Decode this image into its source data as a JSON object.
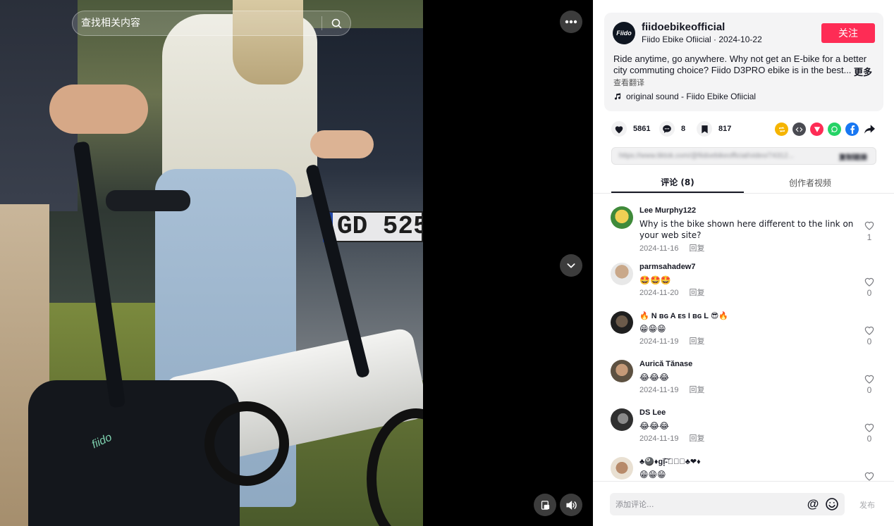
{
  "search": {
    "placeholder": "查找相关内容"
  },
  "video": {
    "plate_text": "GD 525",
    "bike_brand": "fiido"
  },
  "author": {
    "avatar_text": "Fiido",
    "handle": "fiidoebikeofficial",
    "meta": "Fiido Ebike Ofiicial · 2024-10-22",
    "follow_label": "关注"
  },
  "post": {
    "description": "Ride anytime, go anywhere. Why not get an E-bike for a better city commuting choice? Fiido D3PRO ebike is in the best...",
    "more_label": "更多",
    "translate_label": "查看翻译",
    "sound": "original sound - Fiido Ebike Ofiicial"
  },
  "stats": {
    "likes": "5861",
    "comments": "8",
    "saves": "817"
  },
  "share_icons": [
    "repost-icon",
    "embed-icon",
    "telegram-icon",
    "whatsapp-icon",
    "facebook-icon",
    "share-arrow-icon"
  ],
  "link": {
    "url": "https://www.tiktok.com/@fiidoebikeofficial/video/74312...",
    "copy_label": "复制链接"
  },
  "tabs": {
    "comments": "评论 (8)",
    "creator_videos": "创作者视频"
  },
  "comments": [
    {
      "user": "Lee Murphy122",
      "text": "Why is the bike shown here different to the link on your web site?",
      "date": "2024-11-16",
      "reply": "回复",
      "likes": "1",
      "avatar_color": "#e4a42c"
    },
    {
      "user": "parmsahadew7",
      "text": "🤩🤩🤩",
      "date": "2024-11-20",
      "reply": "回复",
      "likes": "0",
      "avatar_color": "#c9a88a"
    },
    {
      "user": "🔥 N ʙɢ A ᴇs I ʙɢ L 😎🔥",
      "text": "😁😁😁",
      "date": "2024-11-19",
      "reply": "回复",
      "likes": "0",
      "avatar_color": "#2b2b2b"
    },
    {
      "user": "Aurică Tănase",
      "text": "😂😂😂",
      "date": "2024-11-19",
      "reply": "回复",
      "likes": "0",
      "avatar_color": "#8c7a62"
    },
    {
      "user": "DS Lee",
      "text": "😂😂😂",
      "date": "2024-11-19",
      "reply": "回复",
      "likes": "0",
      "avatar_color": "#3d3d3d"
    },
    {
      "user": "♣🎱♦gǐ͓̽͠-⃠⃠⃠♣❤♦",
      "text": "😁😁😁",
      "date": "",
      "reply": "",
      "likes": "",
      "avatar_color": "#b78a6a"
    }
  ],
  "composer": {
    "placeholder": "添加评论...",
    "mention": "@",
    "post_label": "发布"
  },
  "colors": {
    "accent": "#fe2c55",
    "text": "#161823",
    "muted": "#7a7b80"
  }
}
